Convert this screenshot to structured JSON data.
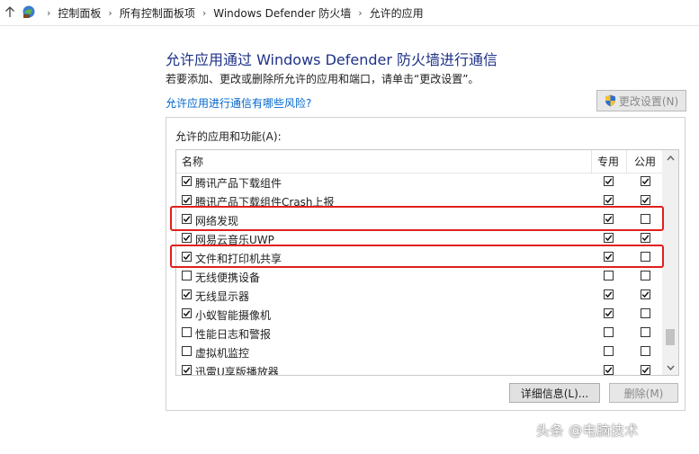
{
  "breadcrumb": [
    "控制面板",
    "所有控制面板项",
    "Windows Defender 防火墙",
    "允许的应用"
  ],
  "header": {
    "title": "允许应用通过 Windows Defender 防火墙进行通信",
    "subtitle": "若要添加、更改或删除所允许的应用和端口，请单击“更改设置”。",
    "risk_link": "允许应用进行通信有哪些风险?",
    "change_settings_label": "更改设置(N)"
  },
  "group": {
    "label": "允许的应用和功能(A):",
    "columns": {
      "name": "名称",
      "private": "专用",
      "public": "公用"
    },
    "rows": [
      {
        "name": "腾讯产品下载组件",
        "enabled": true,
        "private": true,
        "public": true
      },
      {
        "name": "腾讯产品下载组件Crash上报",
        "enabled": true,
        "private": true,
        "public": true
      },
      {
        "name": "网络发现",
        "enabled": true,
        "private": true,
        "public": false
      },
      {
        "name": "网易云音乐UWP",
        "enabled": true,
        "private": true,
        "public": true
      },
      {
        "name": "文件和打印机共享",
        "enabled": true,
        "private": true,
        "public": false
      },
      {
        "name": "无线便携设备",
        "enabled": false,
        "private": false,
        "public": false
      },
      {
        "name": "无线显示器",
        "enabled": true,
        "private": true,
        "public": true
      },
      {
        "name": "小蚁智能摄像机",
        "enabled": true,
        "private": true,
        "public": false
      },
      {
        "name": "性能日志和警报",
        "enabled": false,
        "private": false,
        "public": false
      },
      {
        "name": "虚拟机监控",
        "enabled": false,
        "private": false,
        "public": false
      },
      {
        "name": "迅雷U享版播放器",
        "enabled": true,
        "private": true,
        "public": true
      }
    ],
    "details_label": "详细信息(L)...",
    "delete_label": "删除(M)"
  },
  "watermark": "头条 @电脑技术",
  "colors": {
    "title": "#1e3287",
    "link": "#0066cc",
    "highlight": "#e0201b"
  }
}
